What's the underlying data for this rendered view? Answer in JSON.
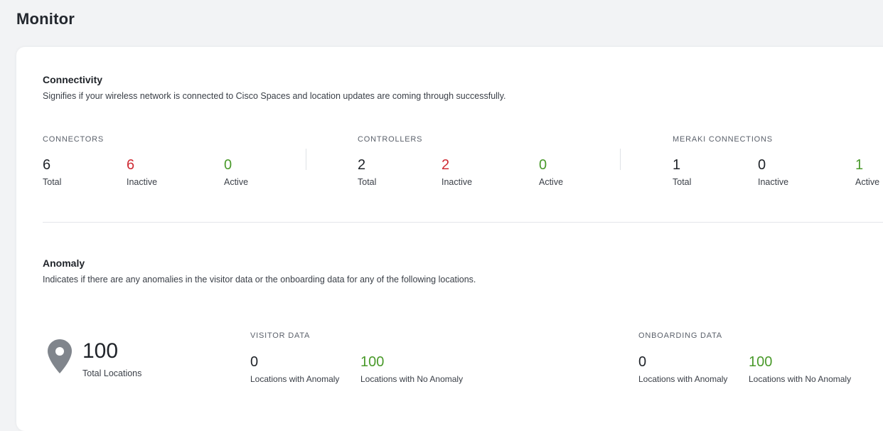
{
  "page": {
    "title": "Monitor"
  },
  "colors": {
    "inactive": "#cf2b34",
    "active": "#4a9a2b",
    "neutral": "#1f2329"
  },
  "connectivity": {
    "title": "Connectivity",
    "description": "Signifies if your wireless network is connected to Cisco Spaces and location updates are coming through successfully.",
    "groups": [
      {
        "label": "CONNECTORS",
        "total": "6",
        "total_label": "Total",
        "inactive": "6",
        "inactive_label": "Inactive",
        "active": "0",
        "active_label": "Active"
      },
      {
        "label": "CONTROLLERS",
        "total": "2",
        "total_label": "Total",
        "inactive": "2",
        "inactive_label": "Inactive",
        "active": "0",
        "active_label": "Active"
      },
      {
        "label": "MERAKI CONNECTIONS",
        "total": "1",
        "total_label": "Total",
        "inactive": "0",
        "inactive_label": "Inactive",
        "active": "1",
        "active_label": "Active"
      }
    ]
  },
  "anomaly": {
    "title": "Anomaly",
    "description": "Indicates if there are any anomalies in the visitor data or the onboarding data for any of the following locations.",
    "total_locations": "100",
    "total_locations_label": "Total Locations",
    "icon": "location-pin-icon",
    "visitor": {
      "label": "VISITOR DATA",
      "with_anomaly": "0",
      "with_anomaly_label": "Locations with Anomaly",
      "no_anomaly": "100",
      "no_anomaly_label": "Locations with No Anomaly"
    },
    "onboarding": {
      "label": "ONBOARDING DATA",
      "with_anomaly": "0",
      "with_anomaly_label": "Locations with Anomaly",
      "no_anomaly": "100",
      "no_anomaly_label": "Locations with No Anomaly"
    }
  }
}
